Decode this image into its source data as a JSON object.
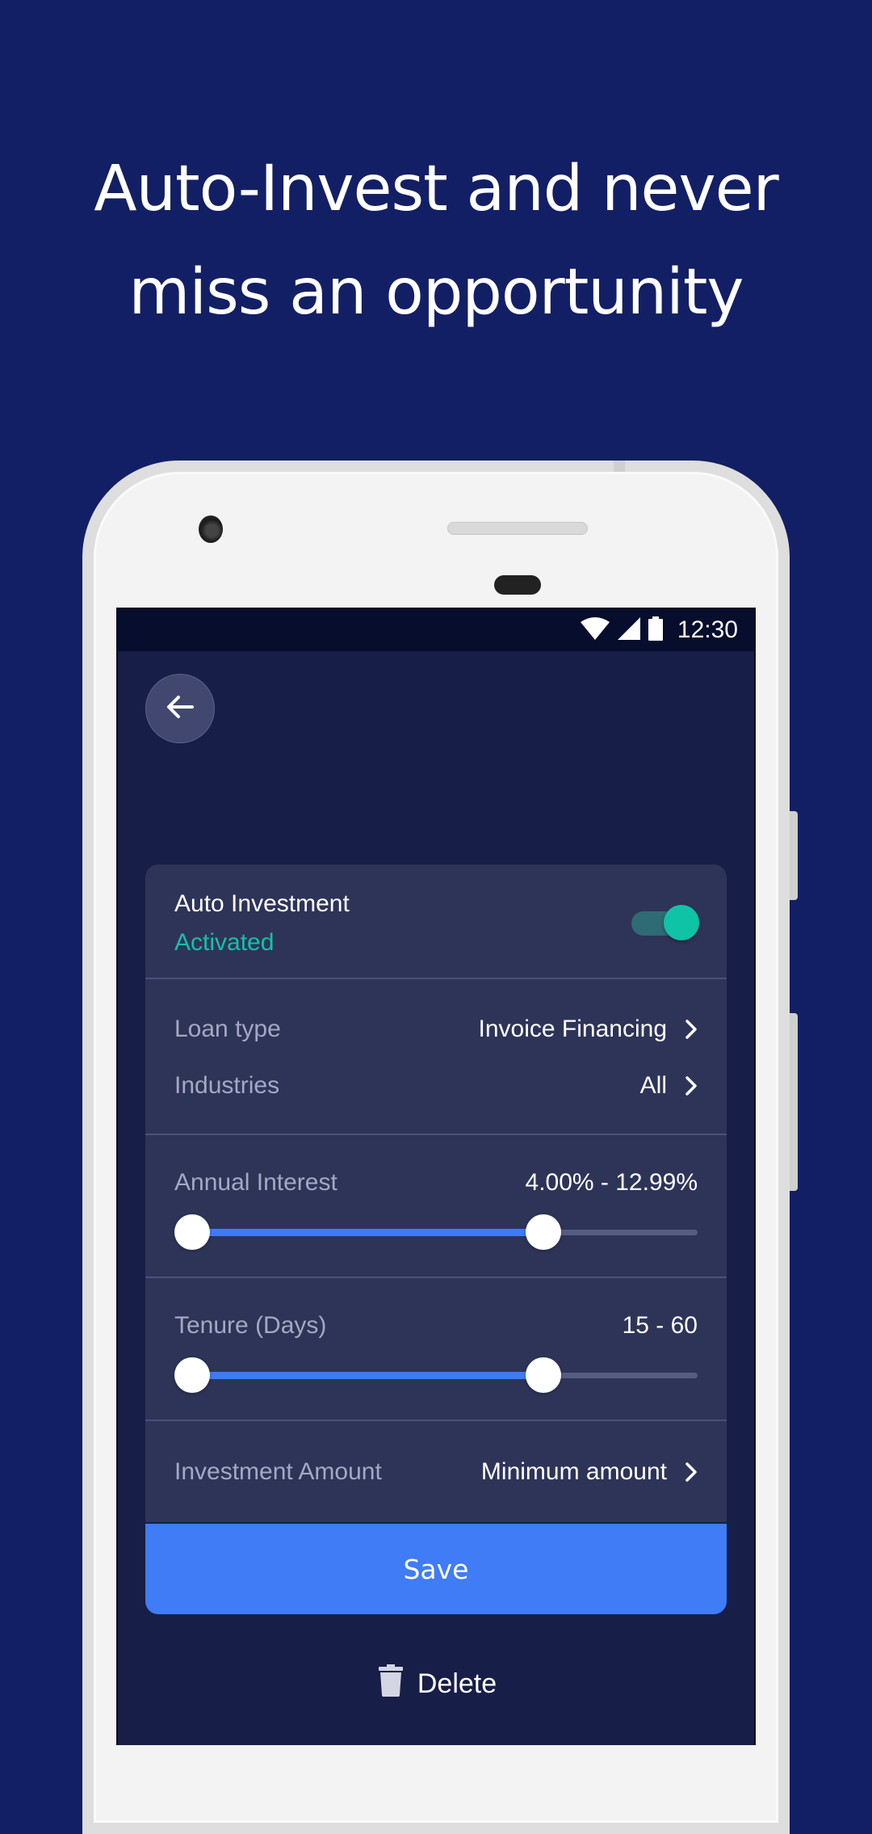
{
  "headline": {
    "line1": "Auto-Invest and never",
    "line2": "miss an opportunity"
  },
  "statusbar": {
    "icons": [
      "wifi-icon",
      "signal-icon",
      "battery-icon"
    ],
    "time": "12:30"
  },
  "back_button": {
    "icon": "arrow-left-icon"
  },
  "auto_investment": {
    "title": "Auto Investment",
    "status": "Activated",
    "enabled": true
  },
  "filters": {
    "loan_type": {
      "label": "Loan type",
      "value": "Invoice Financing"
    },
    "industries": {
      "label": "Industries",
      "value": "All"
    }
  },
  "annual_interest": {
    "label": "Annual Interest",
    "value": "4.00% - 12.99%",
    "range_fraction": [
      0.0,
      0.72
    ]
  },
  "tenure": {
    "label": "Tenure (Days)",
    "value": "15 - 60",
    "range_fraction": [
      0.0,
      0.72
    ]
  },
  "investment_amount": {
    "label": "Investment Amount",
    "value": "Minimum amount"
  },
  "actions": {
    "save_label": "Save",
    "delete_label": "Delete"
  },
  "colors": {
    "background": "#131f64",
    "screen": "#171e47",
    "card": "#2e3458",
    "accent_blue": "#3f7cf6",
    "accent_teal": "#0fc3a6"
  }
}
